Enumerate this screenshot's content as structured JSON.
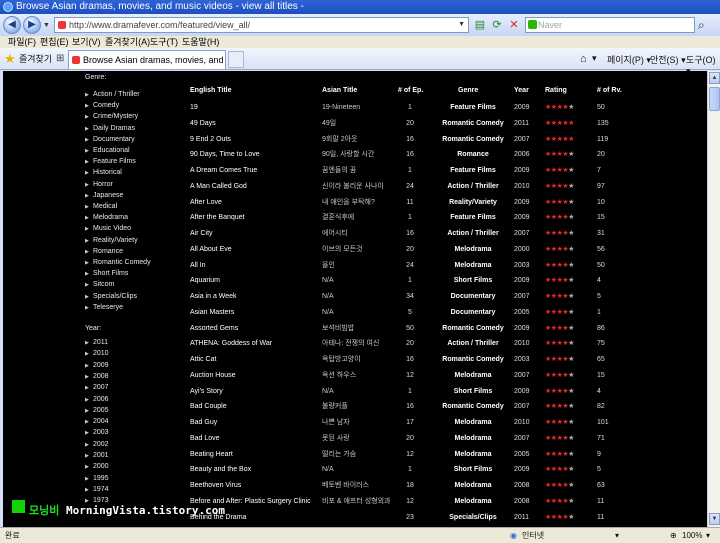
{
  "window": {
    "title": "Browse Asian dramas, movies, and music videos - view all titles -"
  },
  "nav": {
    "url": "http://www.dramafever.com/featured/view_all/",
    "search_placeholder": "Naver",
    "icons": [
      "back-icon",
      "forward-icon",
      "refresh-icon",
      "stop-icon",
      "search-icon"
    ]
  },
  "menu": [
    "파일(F)",
    "편집(E)",
    "보기(V)",
    "즐겨찾기(A)",
    "도구(T)",
    "도움말(H)"
  ],
  "favorites": {
    "label": "즐겨찾기"
  },
  "tab": {
    "label": "Browse Asian dramas, movies, and music vi..."
  },
  "toolbar_right": {
    "page": "페이지(P)",
    "safety": "안전(S)",
    "tools": "도구(O)"
  },
  "sidebar": {
    "genre_heading": "Genre:",
    "genres": [
      "Action / Thriller",
      "Comedy",
      "Crime/Mystery",
      "Daily Dramas",
      "Documentary",
      "Educational",
      "Feature Films",
      "Historical",
      "Horror",
      "Japanese",
      "Medical",
      "Melodrama",
      "Music Video",
      "Reality/Variety",
      "Romance",
      "Romantic Comedy",
      "Short Films",
      "Sitcom",
      "Specials/Clips",
      "Teleserye"
    ],
    "year_heading": "Year:",
    "years": [
      "2011",
      "2010",
      "2009",
      "2008",
      "2007",
      "2006",
      "2005",
      "2004",
      "2003",
      "2002",
      "2001",
      "2000",
      "1995",
      "1974",
      "1973"
    ]
  },
  "table": {
    "headers": {
      "title": "English Title",
      "asian": "Asian Title",
      "eps": "# of Ep.",
      "genre": "Genre",
      "year": "Year",
      "rating": "Rating",
      "reviews": "# of Rv."
    },
    "rows": [
      {
        "title": "19",
        "asian": "19-Nineteen",
        "eps": "1",
        "genre": "Feature Films",
        "year": "2009",
        "rating": 4.5,
        "stars": "★★★★★",
        "reviews": "50"
      },
      {
        "title": "49 Days",
        "asian": "49일",
        "eps": "20",
        "genre": "Romantic Comedy",
        "year": "2011",
        "rating": 5,
        "stars": "★★★★★",
        "reviews": "135"
      },
      {
        "title": "9 End 2 Outs",
        "asian": "9회말 2아웃",
        "eps": "16",
        "genre": "Romantic Comedy",
        "year": "2007",
        "rating": 5,
        "stars": "★★★★★",
        "reviews": "119"
      },
      {
        "title": "90 Days, Time to Love",
        "asian": "90일, 사랑할 시간",
        "eps": "16",
        "genre": "Romance",
        "year": "2006",
        "rating": 4,
        "stars": "★★★★★",
        "reviews": "20"
      },
      {
        "title": "A Dream Comes True",
        "asian": "꿈엔들의 꿈",
        "eps": "1",
        "genre": "Feature Films",
        "year": "2009",
        "rating": 4,
        "stars": "★★★★★",
        "reviews": "7"
      },
      {
        "title": "A Man Called God",
        "asian": "신이라 불리운 사나이",
        "eps": "24",
        "genre": "Action / Thriller",
        "year": "2010",
        "rating": 4,
        "stars": "★★★★★",
        "reviews": "97"
      },
      {
        "title": "After Love",
        "asian": "내 애인을 부탁해?",
        "eps": "11",
        "genre": "Reality/Variety",
        "year": "2009",
        "rating": 4,
        "stars": "★★★★★",
        "reviews": "10"
      },
      {
        "title": "After the Banquet",
        "asian": "결혼식후에",
        "eps": "1",
        "genre": "Feature Films",
        "year": "2009",
        "rating": 4,
        "stars": "★★★★★",
        "reviews": "15"
      },
      {
        "title": "Air City",
        "asian": "에어시티",
        "eps": "16",
        "genre": "Action / Thriller",
        "year": "2007",
        "rating": 4,
        "stars": "★★★★★",
        "reviews": "31"
      },
      {
        "title": "All About Eve",
        "asian": "이브의 모든것",
        "eps": "20",
        "genre": "Melodrama",
        "year": "2000",
        "rating": 4,
        "stars": "★★★★★",
        "reviews": "56"
      },
      {
        "title": "All In",
        "asian": "올인",
        "eps": "24",
        "genre": "Melodrama",
        "year": "2003",
        "rating": 4.5,
        "stars": "★★★★★",
        "reviews": "50"
      },
      {
        "title": "Aquarium",
        "asian": "N/A",
        "eps": "1",
        "genre": "Short Films",
        "year": "2009",
        "rating": 4,
        "stars": "★★★★★",
        "reviews": "4"
      },
      {
        "title": "Asia in a Week",
        "asian": "N/A",
        "eps": "34",
        "genre": "Documentary",
        "year": "2007",
        "rating": 4,
        "stars": "★★★★★",
        "reviews": "5"
      },
      {
        "title": "Asian Masters",
        "asian": "N/A",
        "eps": "5",
        "genre": "Documentary",
        "year": "2005",
        "rating": 4,
        "stars": "★★★★★",
        "reviews": "1"
      },
      {
        "title": "Assorted Gems",
        "asian": "보석비빔밥",
        "eps": "50",
        "genre": "Romantic Comedy",
        "year": "2009",
        "rating": 4.5,
        "stars": "★★★★★",
        "reviews": "86"
      },
      {
        "title": "ATHENA: Goddess of War",
        "asian": "아테나: 전쟁의 여신",
        "eps": "20",
        "genre": "Action / Thriller",
        "year": "2010",
        "rating": 4.5,
        "stars": "★★★★★",
        "reviews": "75"
      },
      {
        "title": "Attic Cat",
        "asian": "옥탑방고양이",
        "eps": "16",
        "genre": "Romantic Comedy",
        "year": "2003",
        "rating": 4.5,
        "stars": "★★★★★",
        "reviews": "65"
      },
      {
        "title": "Auction House",
        "asian": "옥션 하우스",
        "eps": "12",
        "genre": "Melodrama",
        "year": "2007",
        "rating": 4,
        "stars": "★★★★★",
        "reviews": "15"
      },
      {
        "title": "Ayi's Story",
        "asian": "N/A",
        "eps": "1",
        "genre": "Short Films",
        "year": "2009",
        "rating": 4,
        "stars": "★★★★★",
        "reviews": "4"
      },
      {
        "title": "Bad Couple",
        "asian": "불량커플",
        "eps": "16",
        "genre": "Romantic Comedy",
        "year": "2007",
        "rating": 4,
        "stars": "★★★★★",
        "reviews": "82"
      },
      {
        "title": "Bad Guy",
        "asian": "나쁜 남자",
        "eps": "17",
        "genre": "Melodrama",
        "year": "2010",
        "rating": 4.5,
        "stars": "★★★★★",
        "reviews": "101"
      },
      {
        "title": "Bad Love",
        "asian": "못된 사랑",
        "eps": "20",
        "genre": "Melodrama",
        "year": "2007",
        "rating": 4,
        "stars": "★★★★★",
        "reviews": "71"
      },
      {
        "title": "Beating Heart",
        "asian": "떨리는 가슴",
        "eps": "12",
        "genre": "Melodrama",
        "year": "2005",
        "rating": 4,
        "stars": "★★★★★",
        "reviews": "9"
      },
      {
        "title": "Beauty and the Box",
        "asian": "N/A",
        "eps": "1",
        "genre": "Short Films",
        "year": "2009",
        "rating": 4,
        "stars": "★★★★★",
        "reviews": "5"
      },
      {
        "title": "Beethoven Virus",
        "asian": "베토벤 바이러스",
        "eps": "18",
        "genre": "Melodrama",
        "year": "2008",
        "rating": 4.5,
        "stars": "★★★★★",
        "reviews": "63"
      },
      {
        "title": "Before and After: Plastic Surgery Clinic",
        "asian": "비포 & 애프터 성형외과",
        "eps": "12",
        "genre": "Melodrama",
        "year": "2008",
        "rating": 4,
        "stars": "★★★★★",
        "reviews": "11"
      },
      {
        "title": "Behind the Drama",
        "asian": "",
        "eps": "23",
        "genre": "Specials/Clips",
        "year": "2011",
        "rating": 4,
        "stars": "★★★★★",
        "reviews": "11"
      }
    ]
  },
  "status": {
    "left": "완료",
    "zone": "인터넷",
    "zoom": "100%"
  },
  "watermark": {
    "korean": "모닝비",
    "site": "MorningVista.tistory.com"
  }
}
